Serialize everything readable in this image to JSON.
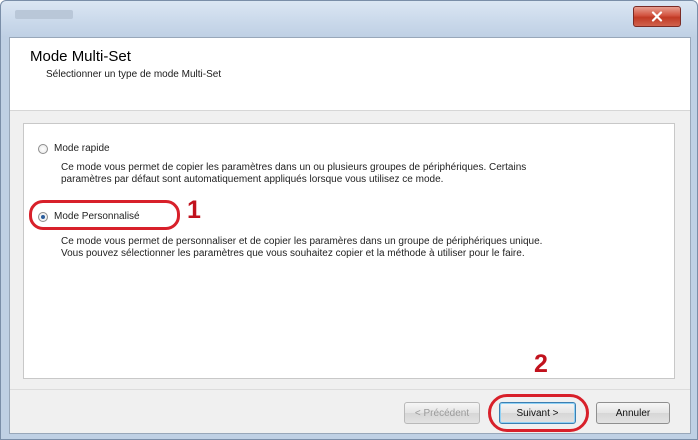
{
  "window": {
    "close_label": "×"
  },
  "header": {
    "title": "Mode Multi-Set",
    "subtitle": "Sélectionner un type de mode Multi-Set"
  },
  "options": [
    {
      "label": "Mode rapide",
      "selected": false,
      "description": [
        "Ce mode vous permet de copier les paramètres dans un ou plusieurs groupes de périphériques. Certains",
        "paramètres par défaut sont automatiquement appliqués lorsque vous utilisez ce mode."
      ]
    },
    {
      "label": "Mode Personnalisé",
      "selected": true,
      "description": [
        "Ce mode vous permet de personnaliser et de copier les paramères dans un groupe de périphériques unique.",
        "Vous pouvez sélectionner les paramètres que vous souhaitez copier et la méthode à utiliser pour le faire."
      ]
    }
  ],
  "callouts": {
    "step1": "1",
    "step2": "2"
  },
  "buttons": {
    "previous": "< Précédent",
    "next": "Suivant >",
    "cancel": "Annuler"
  },
  "colors": {
    "annotation_red": "#d8202a",
    "selected_radio": "#2b5d9c",
    "close_button": "#c13a24"
  }
}
